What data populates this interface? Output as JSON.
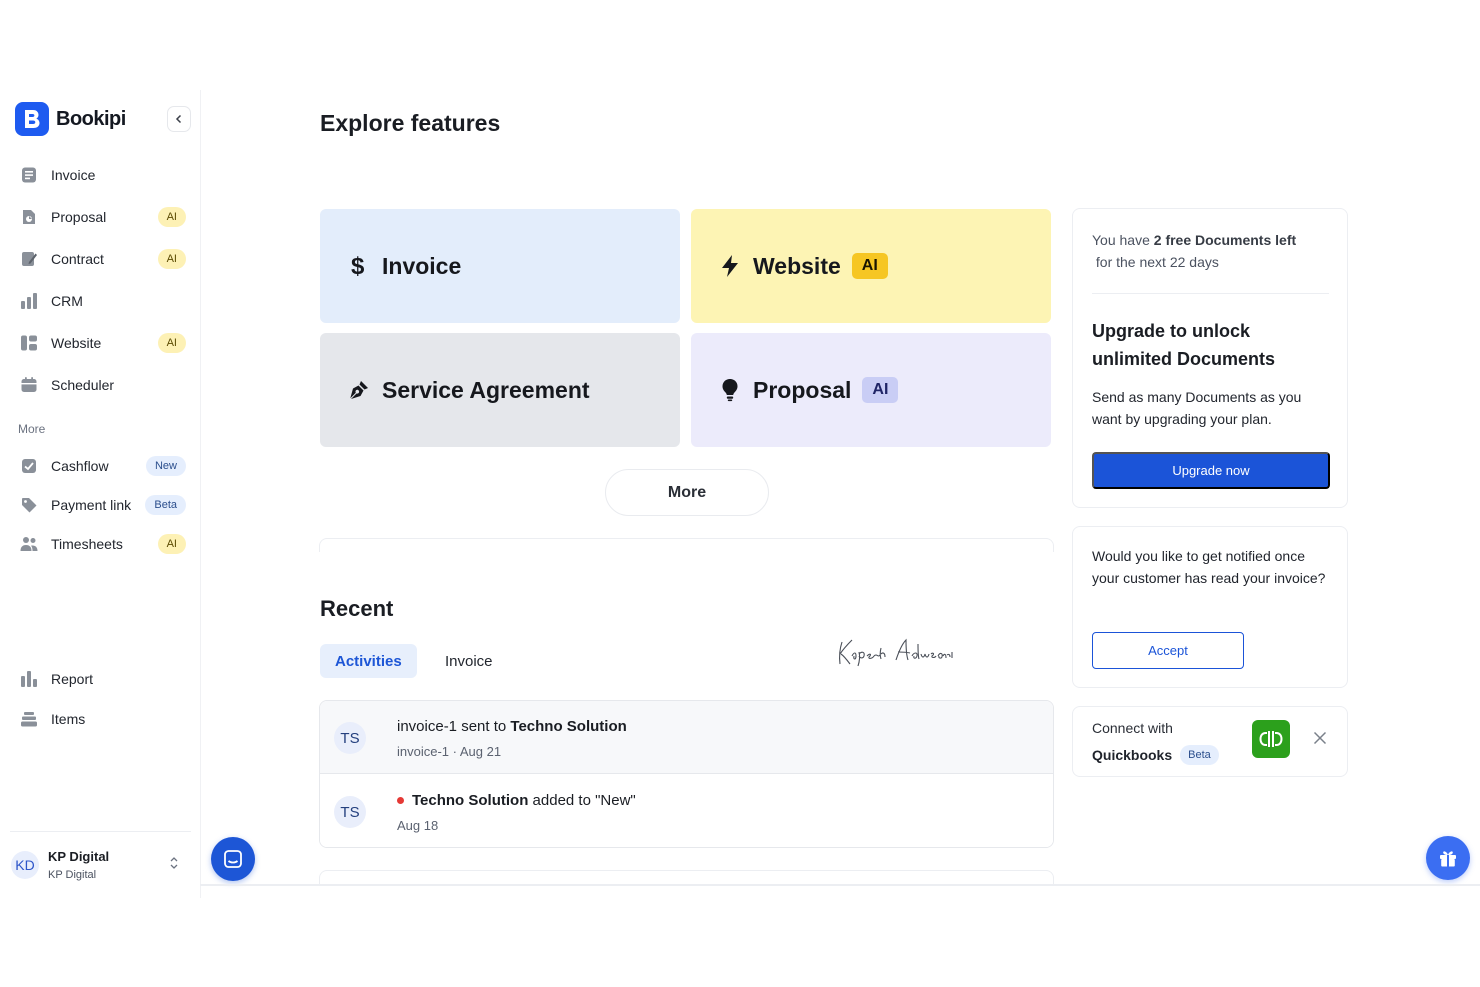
{
  "brand": {
    "name": "Bookipi"
  },
  "sidebar": {
    "items": [
      {
        "label": "Invoice",
        "badge": ""
      },
      {
        "label": "Proposal",
        "badge": "AI"
      },
      {
        "label": "Contract",
        "badge": "AI"
      },
      {
        "label": "CRM",
        "badge": ""
      },
      {
        "label": "Website",
        "badge": "AI"
      },
      {
        "label": "Scheduler",
        "badge": ""
      }
    ],
    "more_heading": "More",
    "more_items": [
      {
        "label": "Cashflow",
        "badge": "New"
      },
      {
        "label": "Payment link",
        "badge": "Beta"
      },
      {
        "label": "Timesheets",
        "badge": "AI"
      }
    ],
    "bottom_items": [
      {
        "label": "Report"
      },
      {
        "label": "Items"
      }
    ],
    "account": {
      "initials": "KD",
      "name": "KP Digital",
      "org": "KP Digital"
    }
  },
  "main": {
    "title": "Explore features",
    "features": [
      {
        "label": "Invoice",
        "badge": "",
        "color": "#e3edfb"
      },
      {
        "label": "Website",
        "badge": "AI",
        "color": "#fdf4b4",
        "badge_color": "#f6c623"
      },
      {
        "label": "Service Agreement",
        "badge": "",
        "color": "#e5e7eb"
      },
      {
        "label": "Proposal",
        "badge": "AI",
        "color": "#ecebfb",
        "badge_color": "#c9cdf5"
      }
    ],
    "more_button": "More",
    "recent": {
      "title": "Recent",
      "tabs": [
        "Activities",
        "Invoice"
      ],
      "activities": [
        {
          "initials": "TS",
          "prefix": "invoice-1 sent to ",
          "bold": "Techno Solution",
          "suffix": "",
          "meta": "invoice-1 · Aug 21"
        },
        {
          "initials": "TS",
          "prefix": "",
          "bold": "Techno Solution",
          "suffix": " added to \"New\"",
          "meta": "Aug 18"
        }
      ]
    }
  },
  "right": {
    "free_docs": {
      "pre": "You have ",
      "bold": "2 free Documents left",
      "post": " for the next 22 days"
    },
    "upgrade": {
      "title": "Upgrade to unlock unlimited Documents",
      "description": "Send as many Documents as you want by upgrading your plan.",
      "button": "Upgrade now"
    },
    "notify": {
      "text": "Would you like to get notified once your customer has read your invoice?",
      "button": "Accept"
    },
    "quickbooks": {
      "line1": "Connect with",
      "name": "Quickbooks",
      "badge": "Beta"
    }
  },
  "colors": {
    "accent": "#1b54d8",
    "brand": "#1e5bf0",
    "quickbooks": "#2ca01c"
  }
}
